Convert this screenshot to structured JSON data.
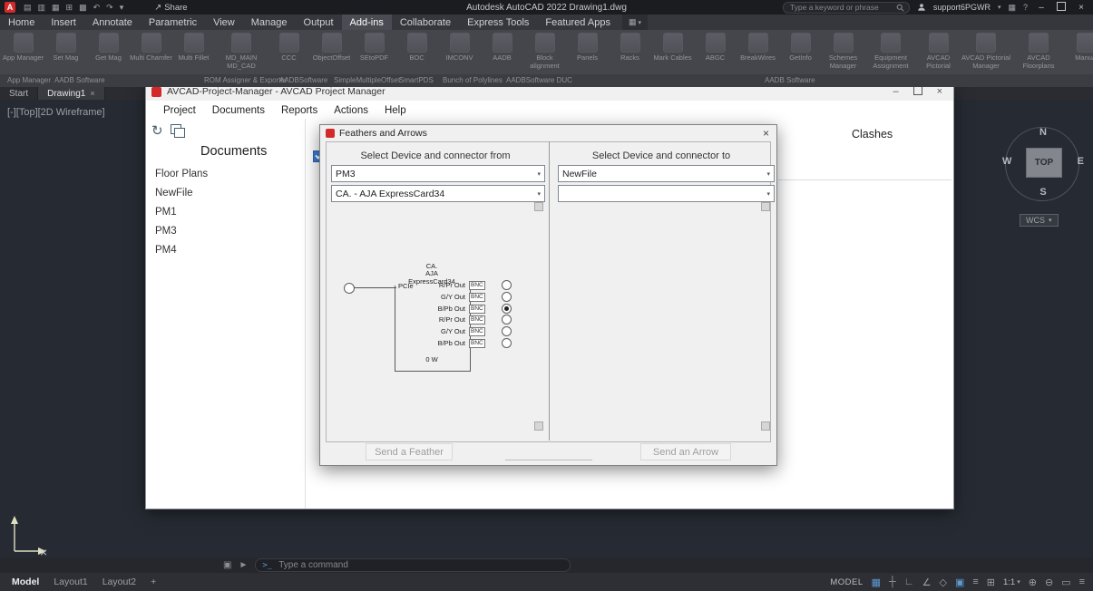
{
  "colors": {
    "accent_blue": "#5d9bd3",
    "dialog_red": "#d22a2a",
    "check_blue": "#3a7bd5"
  },
  "glyphs": {
    "app_letter": "A",
    "minimize": "–",
    "close": "×",
    "caret_down": "▾",
    "share_arrow": "↗",
    "help": "?",
    "box": "▦",
    "refresh": "↻",
    "crosshair": "×",
    "customize": "▣",
    "cursor": "►",
    "add": "+"
  },
  "qat": [
    {
      "name": "new-file",
      "glyph": "▤"
    },
    {
      "name": "open-file",
      "glyph": "▥"
    },
    {
      "name": "save-file",
      "glyph": "▦"
    },
    {
      "name": "save-as",
      "glyph": "⊞"
    },
    {
      "name": "plot",
      "glyph": "▩"
    },
    {
      "name": "undo",
      "glyph": "↶"
    },
    {
      "name": "redo",
      "glyph": "↷"
    },
    {
      "name": "qat-menu",
      "glyph": "▾"
    }
  ],
  "chrome": {
    "app_title": "Autodesk AutoCAD 2022  Drawing1.dwg",
    "share_label": "Share",
    "search_placeholder": "Type a keyword or phrase",
    "account_name": "support6PGWR"
  },
  "menubar": {
    "items": [
      "Home",
      "Insert",
      "Annotate",
      "Parametric",
      "View",
      "Manage",
      "Output",
      "Add-ins",
      "Collaborate",
      "Express Tools",
      "Featured Apps"
    ]
  },
  "ribbon": {
    "buttons": [
      {
        "label": "App Manager"
      },
      {
        "label": "Set Mag"
      },
      {
        "label": "Get Mag"
      },
      {
        "label": "Multi Chamfer"
      },
      {
        "label": "Multi Fillet"
      },
      {
        "label": "MD_MAIN MD_CAD"
      },
      {
        "label": "CCC"
      },
      {
        "label": "ObjectOffset"
      },
      {
        "label": "SEtoPDF"
      },
      {
        "label": "BOC"
      },
      {
        "label": "IMCONV"
      },
      {
        "label": "AADB"
      },
      {
        "label": "Block alignment"
      },
      {
        "label": "Panels"
      },
      {
        "label": "Racks"
      },
      {
        "label": "Mark Cables"
      },
      {
        "label": "ABGC"
      },
      {
        "label": "BreakWires"
      },
      {
        "label": "GetInfo"
      },
      {
        "label": "Schemes Manager"
      },
      {
        "label": "Equipment Assignment"
      },
      {
        "label": "AVCAD Pictorial"
      },
      {
        "label": "AVCAD Pictorial Manager"
      },
      {
        "label": "AVCAD Floorplans"
      },
      {
        "label": "Manual"
      }
    ],
    "groups": [
      "App Manager",
      "AADB Software",
      "ROM Assigner & Exporter",
      "AADBSoftware",
      "SimpleMultipleOffset",
      "SmartPDS",
      "Bunch of Polylines",
      "AADBSoftware DUC",
      "AADB Software"
    ]
  },
  "filetabs": [
    "Start",
    "Drawing1"
  ],
  "viewport": {
    "label": "[-][Top][2D Wireframe]",
    "viewcube": {
      "n": "N",
      "w": "W",
      "e": "E",
      "s": "S",
      "face": "TOP"
    },
    "wcs": "WCS"
  },
  "pm_window": {
    "title": "AVCAD-Project-Manager - AVCAD Project Manager",
    "menu": [
      "Project",
      "Documents",
      "Reports",
      "Actions",
      "Help"
    ],
    "documents_heading": "Documents",
    "documents": [
      "Floor Plans",
      "NewFile",
      "PM1",
      "PM3",
      "PM4"
    ],
    "clashes_heading": "Clashes"
  },
  "dialog": {
    "title": "Feathers and Arrows",
    "from_heading": "Select Device and connector from",
    "from_device": "PM3",
    "from_connector": "CA. - AJA ExpressCard34",
    "to_heading": "Select Device and connector to",
    "to_device": "NewFile",
    "to_connector": "",
    "device": {
      "name_lines": [
        "CA.",
        "AJA",
        "ExpressCard34"
      ],
      "left_pin": "PCIe",
      "power": "0 W",
      "pins": [
        {
          "label": "R/Pr Out",
          "conn": "BNC",
          "selected": false
        },
        {
          "label": "G/Y Out",
          "conn": "BNC",
          "selected": false
        },
        {
          "label": "B/Pb Out",
          "conn": "BNC",
          "selected": true
        },
        {
          "label": "R/Pr Out",
          "conn": "BNC",
          "selected": false
        },
        {
          "label": "G/Y Out",
          "conn": "BNC",
          "selected": false
        },
        {
          "label": "B/Pb Out",
          "conn": "BNC",
          "selected": false
        }
      ]
    },
    "send_feather_label": "Send a Feather",
    "send_arrow_label": "Send an Arrow"
  },
  "commandline": {
    "prompt": ">_",
    "placeholder": "Type a command"
  },
  "statusbar": {
    "tabs": [
      "Model",
      "Layout1",
      "Layout2"
    ],
    "add_tab": "+",
    "model_label": "MODEL",
    "scale": "1:1",
    "icons": [
      {
        "name": "grid-icon",
        "glyph": "▦"
      },
      {
        "name": "snap-icon",
        "glyph": "┼"
      },
      {
        "name": "ortho-icon",
        "glyph": "∟"
      },
      {
        "name": "polar-icon",
        "glyph": "∠"
      },
      {
        "name": "isodraft-icon",
        "glyph": "◇"
      },
      {
        "name": "osnap-icon",
        "glyph": "▣"
      },
      {
        "name": "lineweight-icon",
        "glyph": "≡"
      },
      {
        "name": "dynamic-input-icon",
        "glyph": "⊞"
      }
    ],
    "right_icons": [
      {
        "name": "annotation-visibility-icon",
        "glyph": "⊕"
      },
      {
        "name": "annotation-autoscale-icon",
        "glyph": "⊖"
      },
      {
        "name": "isolate-objects-icon",
        "glyph": "▭"
      },
      {
        "name": "customization-icon",
        "glyph": "≡"
      }
    ]
  }
}
